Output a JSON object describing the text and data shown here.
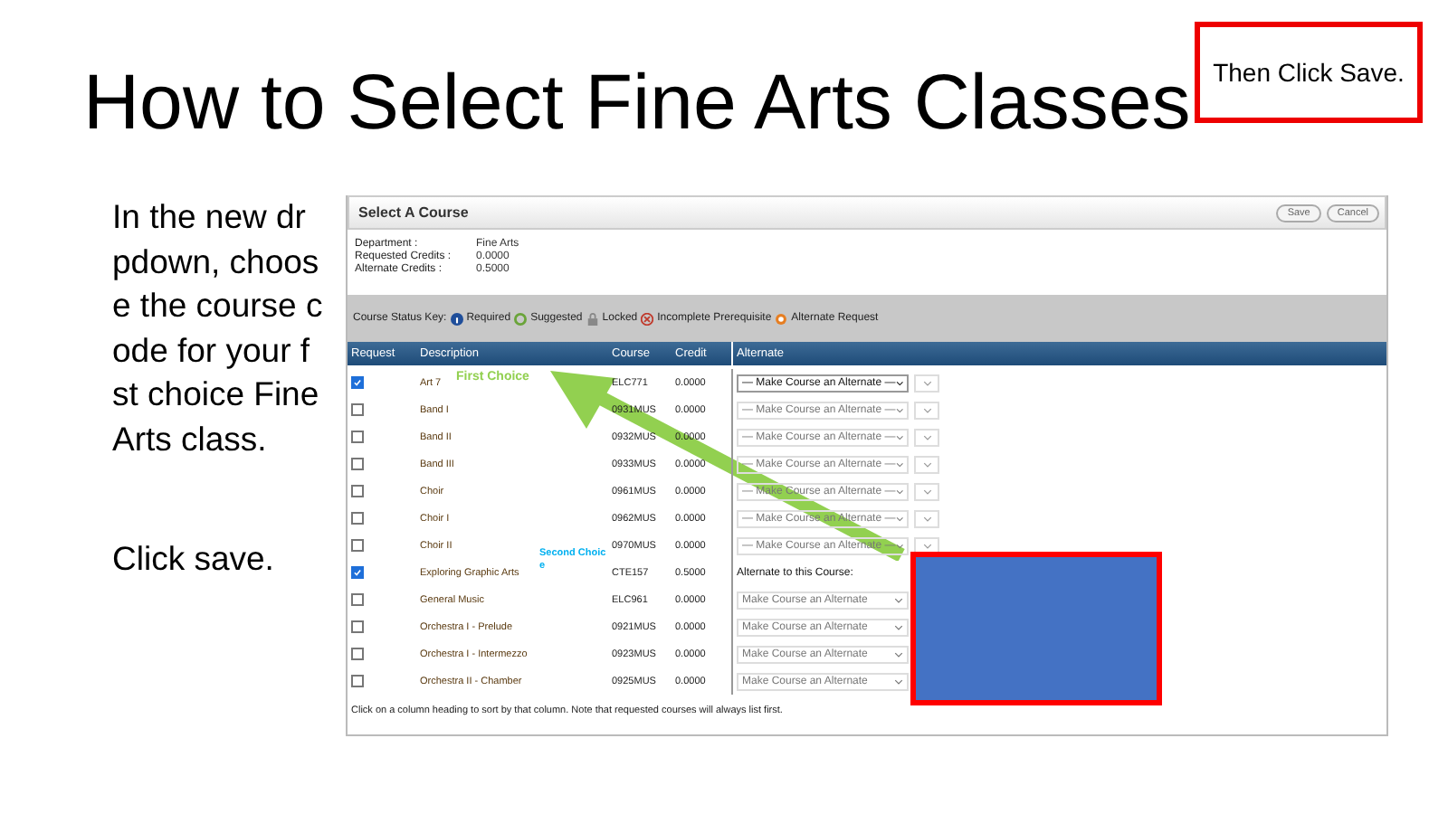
{
  "slide": {
    "title": "How to Select Fine Arts Classes",
    "callout": "Then Click Save.",
    "instructions": [
      "In the new dr",
      "pdown, choos",
      "e the course c",
      "ode for your f",
      "st choice Fine",
      "Arts class."
    ],
    "second_instruction": "Click save."
  },
  "screenshot": {
    "title": "Select A Course",
    "buttons": [
      "Save",
      "Cancel"
    ],
    "info": [
      {
        "label": "Department :",
        "value": "Fine Arts"
      },
      {
        "label": "Requested Credits :",
        "value": "0.0000"
      },
      {
        "label": "Alternate Credits :",
        "value": "0.5000"
      }
    ],
    "status_key": {
      "label": "Course Status Key:",
      "items": [
        {
          "kind": "required",
          "text": "Required"
        },
        {
          "kind": "suggested",
          "text": "Suggested"
        },
        {
          "kind": "locked",
          "text": "Locked"
        },
        {
          "kind": "incomplete",
          "text": "Incomplete Prerequisite"
        },
        {
          "kind": "alternate",
          "text": "Alternate Request"
        }
      ]
    },
    "columns": [
      "Request",
      "Description",
      "Course",
      "Credit",
      "Alternate"
    ],
    "rows": [
      {
        "checked": true,
        "description": "Art 7",
        "course": "ELC771",
        "credit": "0.0000",
        "alternate": {
          "kind": "select",
          "value": "— Make Course an Alternate —",
          "disabled": false,
          "second_dropdown": true
        }
      },
      {
        "checked": false,
        "description": "Band I",
        "course": "0931MUS",
        "credit": "0.0000",
        "alternate": {
          "kind": "select",
          "value": "— Make Course an Alternate —",
          "disabled": true,
          "second_dropdown": true
        }
      },
      {
        "checked": false,
        "description": "Band II",
        "course": "0932MUS",
        "credit": "0.0000",
        "alternate": {
          "kind": "select",
          "value": "— Make Course an Alternate —",
          "disabled": true,
          "second_dropdown": true
        }
      },
      {
        "checked": false,
        "description": "Band III",
        "course": "0933MUS",
        "credit": "0.0000",
        "alternate": {
          "kind": "select",
          "value": "— Make Course an Alternate —",
          "disabled": true,
          "second_dropdown": true
        }
      },
      {
        "checked": false,
        "description": "Choir",
        "course": "0961MUS",
        "credit": "0.0000",
        "alternate": {
          "kind": "select",
          "value": "— Make Course an Alternate —",
          "disabled": true,
          "second_dropdown": true
        }
      },
      {
        "checked": false,
        "description": "Choir I",
        "course": "0962MUS",
        "credit": "0.0000",
        "alternate": {
          "kind": "select",
          "value": "— Make Course an Alternate —",
          "disabled": true,
          "second_dropdown": true
        }
      },
      {
        "checked": false,
        "description": "Choir II",
        "course": "0970MUS",
        "credit": "0.0000",
        "alternate": {
          "kind": "select",
          "value": "— Make Course an Alternate —",
          "disabled": true,
          "second_dropdown": true
        }
      },
      {
        "checked": true,
        "description": "Exploring Graphic Arts",
        "course": "CTE157",
        "credit": "0.5000",
        "alternate": {
          "kind": "text",
          "value": "Alternate to this Course:"
        }
      },
      {
        "checked": false,
        "description": "General Music",
        "course": "ELC961",
        "credit": "0.0000",
        "alternate": {
          "kind": "select",
          "value": "Make Course an Alternate",
          "disabled": true
        }
      },
      {
        "checked": false,
        "description": "Orchestra I - Prelude",
        "course": "0921MUS",
        "credit": "0.0000",
        "alternate": {
          "kind": "select",
          "value": "Make Course an Alternate",
          "disabled": true
        }
      },
      {
        "checked": false,
        "description": "Orchestra I - Intermezzo",
        "course": "0923MUS",
        "credit": "0.0000",
        "alternate": {
          "kind": "select",
          "value": "Make Course an Alternate",
          "disabled": true
        }
      },
      {
        "checked": false,
        "description": "Orchestra II - Chamber",
        "course": "0925MUS",
        "credit": "0.0000",
        "alternate": {
          "kind": "select",
          "value": "Make Course an Alternate",
          "disabled": true
        }
      }
    ],
    "footer": "Click on a column heading to sort by that column. Note that requested courses will always list first."
  },
  "annotations": [
    {
      "text": "First Choice",
      "color": "#92d050"
    },
    {
      "text": "Second Choic e",
      "color": "#00b0f0"
    }
  ]
}
